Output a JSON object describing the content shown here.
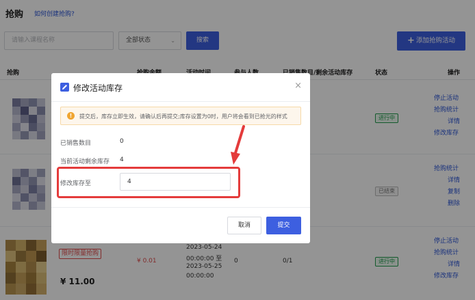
{
  "page": {
    "title": "抢购",
    "help_link": "如何创建抢购?"
  },
  "toolbar": {
    "search_placeholder": "请输入课程名称",
    "status_select": "全部状态",
    "query_button": "搜索",
    "add_button": "添加抢购活动"
  },
  "table": {
    "headers": {
      "item": "抢购",
      "price": "抢购金额",
      "time": "活动时间",
      "participants": "参与人数",
      "sold": "已销售数目/剩余活动库存",
      "status": "状态",
      "ops": "操作"
    },
    "rows": [
      {
        "status": "进行中",
        "ops": [
          "停止活动",
          "抢购统计",
          "详情",
          "修改库存"
        ]
      },
      {
        "status": "已结束",
        "ops": [
          "抢购统计",
          "详情",
          "复制",
          "删除"
        ]
      },
      {
        "tag": "限时限量抢购",
        "price_main": "¥ 11.00",
        "price_act": "¥ 0.01",
        "time_lines": [
          "2023-05-24",
          "00:00:00 至",
          "2023-05-25",
          "00:00:00"
        ],
        "participants": "0",
        "sold": "0/1",
        "status": "进行中",
        "ops": [
          "停止活动",
          "抢购统计",
          "详情",
          "修改库存"
        ]
      }
    ]
  },
  "modal": {
    "title": "修改活动库存",
    "close": "×",
    "alert": "提交后，库存立即生效，请确认后再提交;库存设置为0时，用户将会看到已抢光的样式",
    "sold_label": "已销售数目",
    "sold_value": "0",
    "remaining_label": "当前活动剩余库存",
    "remaining_value": "4",
    "modify_label": "修改库存至",
    "modify_value": "4",
    "cancel": "取消",
    "submit": "提交"
  },
  "colors": {
    "primary": "#3d5fe0",
    "danger": "#e14c4c",
    "success": "#1f9b4b",
    "annotation": "#e43b3b"
  }
}
